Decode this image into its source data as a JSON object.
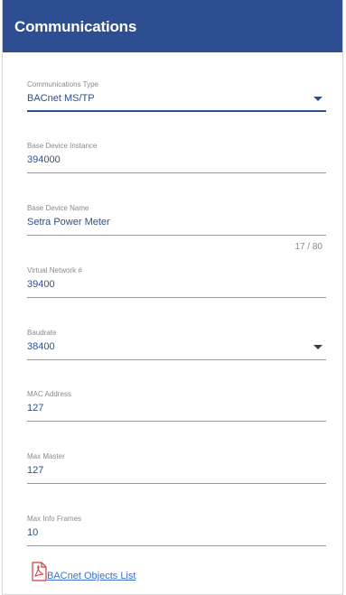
{
  "header": {
    "title": "Communications"
  },
  "fields": [
    {
      "label": "Communications Type",
      "value": "BACnet MS/TP",
      "type": "select",
      "active": true
    },
    {
      "label": "Base Device Instance",
      "value": "394000",
      "type": "text"
    },
    {
      "label": "Base Device Name",
      "value": "Setra Power Meter",
      "type": "text",
      "counter": "17 / 80"
    },
    {
      "label": "Virtual Network #",
      "value": "39400",
      "type": "text"
    },
    {
      "label": "Baudrate",
      "value": "38400",
      "type": "select"
    },
    {
      "label": "MAC Address",
      "value": "127",
      "type": "text"
    },
    {
      "label": "Max Master",
      "value": "127",
      "type": "text"
    },
    {
      "label": "Max Info Frames",
      "value": "10",
      "type": "text"
    }
  ],
  "link": {
    "label": "BACnet Objects List",
    "icon": "pdf-icon"
  },
  "colors": {
    "header": "#2d4f92",
    "value_text": "#2d4f92",
    "link": "#3b6fd1"
  }
}
